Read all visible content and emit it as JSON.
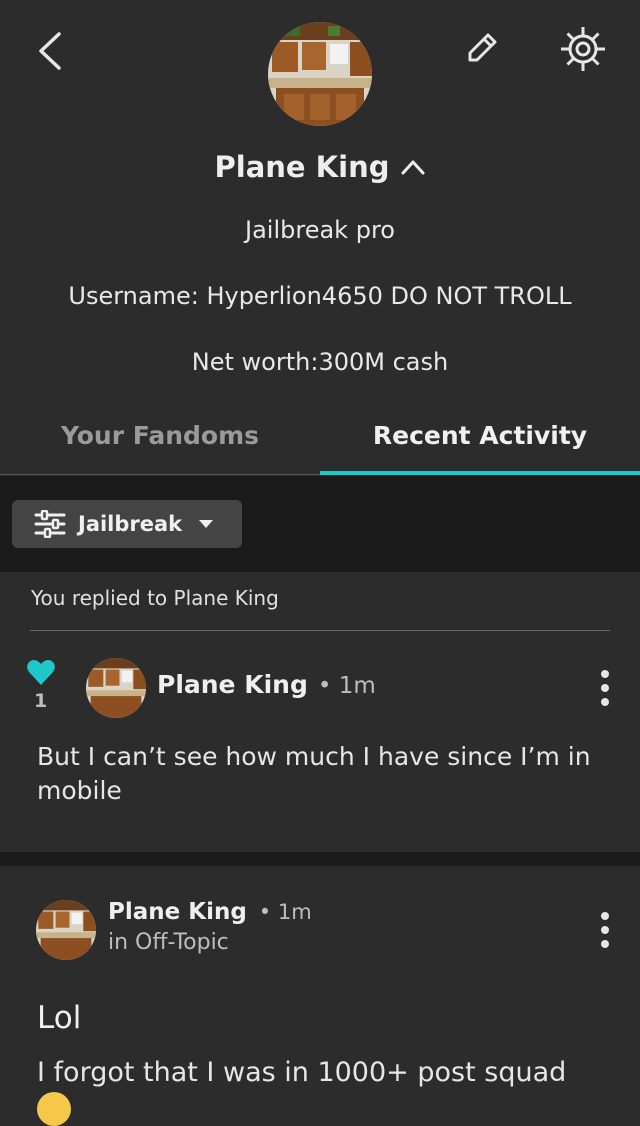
{
  "profile": {
    "name": "Plane King",
    "bio_lines": [
      "Jailbreak pro",
      "Username: Hyperlion4650 DO NOT TROLL",
      "Net worth:300M cash"
    ]
  },
  "tabs": [
    {
      "label": "Your Fandoms",
      "active": false
    },
    {
      "label": "Recent Activity",
      "active": true
    }
  ],
  "filter": {
    "label": "Jailbreak"
  },
  "activity": {
    "context": "You replied to Plane King",
    "like_count": "1",
    "author": "Plane King",
    "time": "• 1m",
    "body": "But I can’t see how much I have since I’m in mobile"
  },
  "post": {
    "author": "Plane King",
    "time": "• 1m",
    "location": "in Off-Topic",
    "title": "Lol",
    "body": "I forgot that I was in 1000+ post squad"
  },
  "colors": {
    "accent": "#1ec8c8",
    "background": "#2c2c2c",
    "band": "#1b1b1b"
  }
}
